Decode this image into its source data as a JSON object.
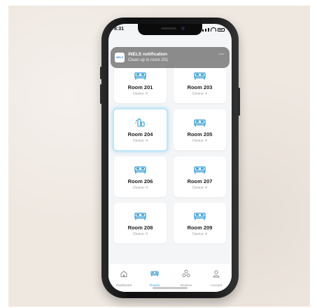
{
  "status_bar": {
    "time": "8:31"
  },
  "notification": {
    "app_badge": "iNELS",
    "title": "iNELS notification",
    "body": "Clean up in room 201",
    "time": "now"
  },
  "rooms": [
    {
      "name": "Room 201",
      "devices": "Device: 4",
      "icon": "bed-icon"
    },
    {
      "name": "Room 203",
      "devices": "Device: 4",
      "icon": "bed-icon"
    },
    {
      "name": "Room 204",
      "devices": "Device: 4",
      "icon": "cleaning-icon",
      "selected": true
    },
    {
      "name": "Room 205",
      "devices": "Device: 4",
      "icon": "bed-icon"
    },
    {
      "name": "Room 206",
      "devices": "Device: 4",
      "icon": "bed-icon"
    },
    {
      "name": "Room 207",
      "devices": "Device: 4",
      "icon": "bed-icon"
    },
    {
      "name": "Room 208",
      "devices": "Device: 4",
      "icon": "bed-icon"
    },
    {
      "name": "Room 209",
      "devices": "Device: 4",
      "icon": "bed-icon"
    }
  ],
  "tabs": [
    {
      "label": "Dashboard",
      "icon": "home-icon"
    },
    {
      "label": "Rooms",
      "icon": "bed-icon",
      "active": true
    },
    {
      "label": "Devices",
      "icon": "devices-icon"
    },
    {
      "label": "Account",
      "icon": "user-icon"
    }
  ],
  "colors": {
    "accent": "#2e9bd6",
    "selected_border": "#bfe6f7"
  }
}
